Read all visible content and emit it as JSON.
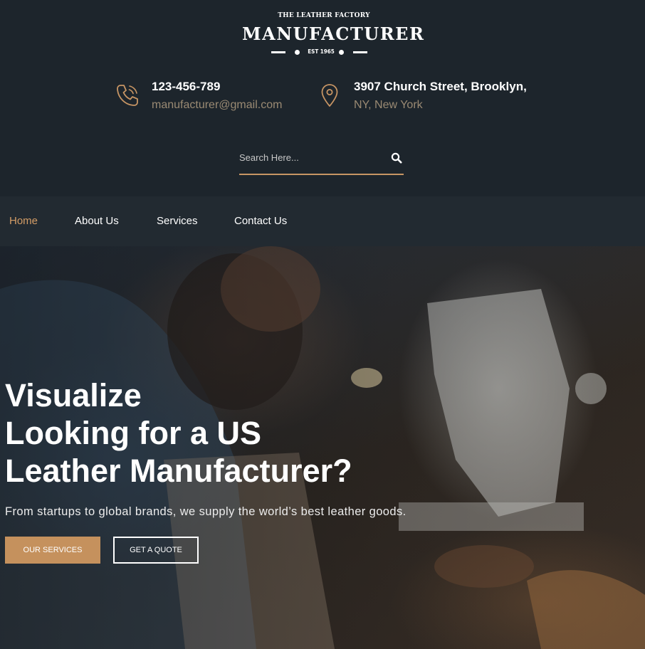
{
  "brand": {
    "tagline": "THE LEATHER FACTORY",
    "name": "MANUFACTURER",
    "est": "EST 1965"
  },
  "contact": {
    "phone": "123-456-789",
    "email": "manufacturer@gmail.com",
    "address_line1": "3907 Church Street, Brooklyn,",
    "address_line2": "NY, New York"
  },
  "search": {
    "placeholder": "Search Here..."
  },
  "nav": {
    "items": [
      {
        "label": "Home",
        "active": true
      },
      {
        "label": "About Us",
        "active": false
      },
      {
        "label": "Services",
        "active": false
      },
      {
        "label": "Contact Us",
        "active": false
      }
    ]
  },
  "hero": {
    "title_lines": [
      "Visualize",
      "Looking for a US",
      "Leather Manufacturer?"
    ],
    "subtitle": "From startups to global brands, we supply the world’s best leather goods.",
    "primary_button": "OUR SERVICES",
    "secondary_button": "GET A QUOTE"
  },
  "colors": {
    "background": "#1d252c",
    "nav_background": "#222a31",
    "accent": "#c5915d",
    "active_nav": "#d49d66",
    "muted_text": "#9a8a73"
  },
  "icons": {
    "phone": "phone-icon",
    "location": "map-pin-icon",
    "search": "search-icon"
  }
}
